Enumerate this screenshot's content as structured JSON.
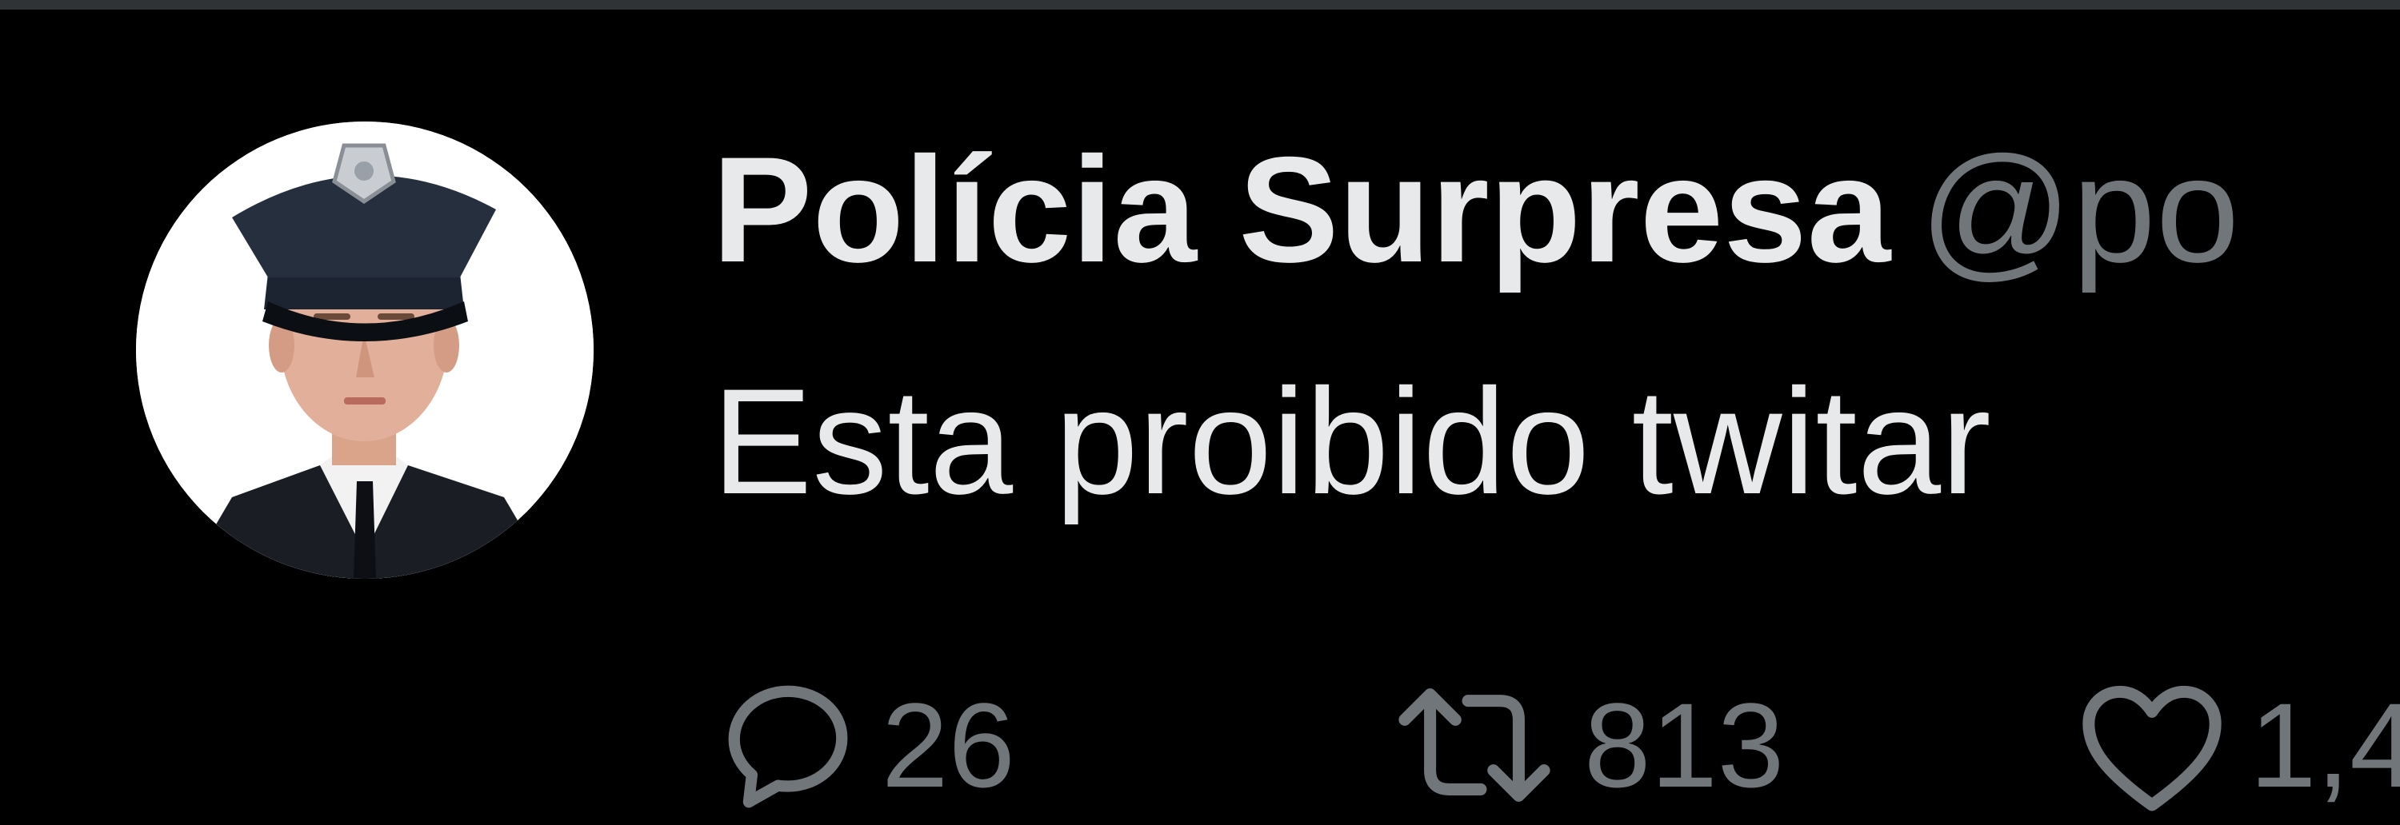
{
  "tweet": {
    "display_name": "Polícia Surpresa",
    "handle": "@po",
    "text": "Esta proibido twitar",
    "avatar_icon": "police-officer-avatar"
  },
  "actions": {
    "reply": {
      "icon": "reply-icon",
      "count": "26"
    },
    "retweet": {
      "icon": "retweet-icon",
      "count": "813"
    },
    "like": {
      "icon": "heart-icon",
      "count": "1,4"
    }
  },
  "colors": {
    "background": "#000000",
    "primary_text": "#e7e9ea",
    "secondary_text": "#71767b",
    "border": "#2f3336"
  }
}
